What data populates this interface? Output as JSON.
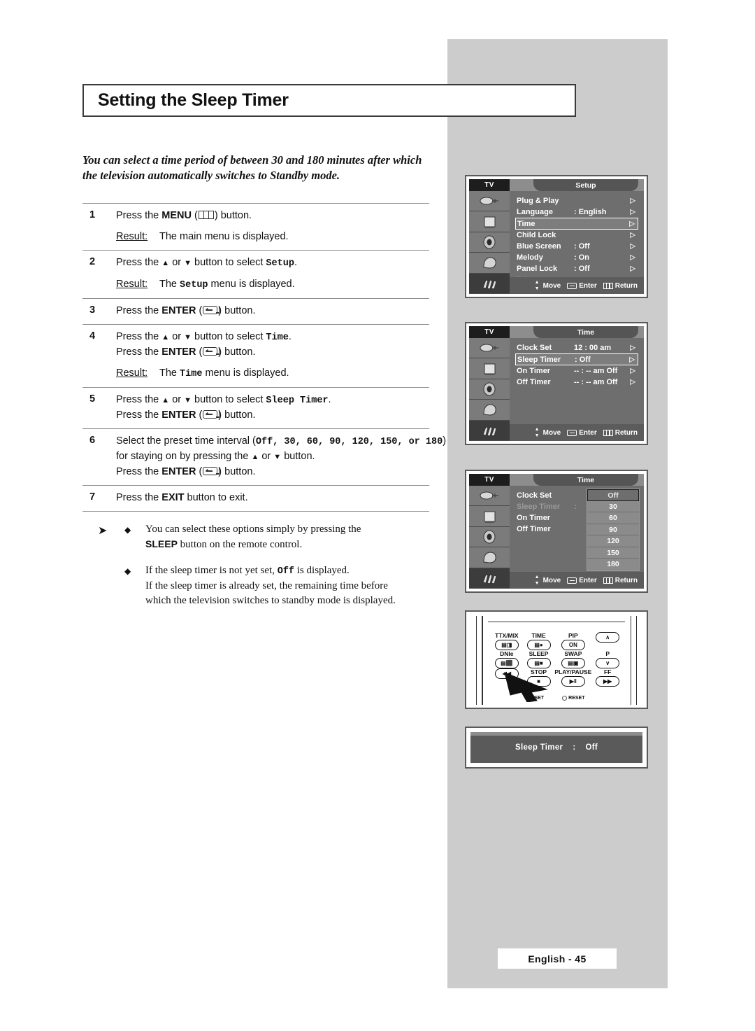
{
  "page": {
    "title": "Setting the Sleep Timer",
    "intro": "You can select a time period of between 30 and 180 minutes after which the television automatically switches to Standby mode.",
    "footer": "English - 45"
  },
  "steps": [
    {
      "num": "1",
      "line1_pre": "Press the ",
      "line1_bold": "MENU",
      "line1_icon": "menu-icon",
      "line1_post": ") button.",
      "result_label": "Result:",
      "result_pre": "The main menu is displayed.",
      "result_mono": "",
      "result_post": ""
    },
    {
      "num": "2",
      "line1_pre": "Press the ",
      "line1_mid": " or ",
      "line1_post": " button to select ",
      "line1_mono": "Setup",
      "line1_end": ".",
      "result_label": "Result:",
      "result_pre": "The ",
      "result_mono": "Setup",
      "result_post": " menu is displayed."
    },
    {
      "num": "3",
      "line1_pre": "Press the ",
      "line1_bold": "ENTER",
      "line1_icon": "enter-icon",
      "line1_post": ") button."
    },
    {
      "num": "4",
      "line1_pre": "Press the ",
      "line1_mid": " or ",
      "line1_post": " button to select ",
      "line1_mono": "Time",
      "line1_end": ".",
      "line2_pre": "Press the ",
      "line2_bold": "ENTER",
      "line2_post": ") button.",
      "result_label": "Result:",
      "result_pre": "The ",
      "result_mono": "Time",
      "result_post": " menu is displayed."
    },
    {
      "num": "5",
      "line1_pre": "Press the ",
      "line1_mid": " or ",
      "line1_post": " button to select ",
      "line1_mono": "Sleep Timer",
      "line1_end": ".",
      "line2_pre": "Press the ",
      "line2_bold": "ENTER",
      "line2_post": ") button."
    },
    {
      "num": "6",
      "line1_pre": "Select the preset time interval (",
      "line1_opts": "Off, 30, 60, 90, 120, 150, or 180",
      "line1_end": ")",
      "line2": "for staying on by pressing the ",
      "line2_post": " button.",
      "line3_pre": "Press the ",
      "line3_bold": "ENTER",
      "line3_post": ") button."
    },
    {
      "num": "7",
      "line1_pre": "Press the ",
      "line1_bold": "EXIT",
      "line1_plain": " button to exit."
    }
  ],
  "notes": [
    {
      "arrow": "note-arrow-icon",
      "bullet": "diamond-bullet-icon",
      "line1": "You can select these options simply by pressing the",
      "bold": "SLEEP",
      "line2_rest": " button on the remote control."
    },
    {
      "bullet": "diamond-bullet-icon",
      "line1_pre": "If the sleep timer is not yet set, ",
      "line1_mono": "Off",
      "line1_post": " is displayed.",
      "line2": "If the sleep timer is already set, the remaining time before",
      "line3": "which the television switches to standby mode is displayed."
    }
  ],
  "osd_setup": {
    "tv_label": "TV",
    "title": "Setup",
    "rows": [
      {
        "label": "Plug & Play",
        "value": "",
        "caret": "▷",
        "state": "normal"
      },
      {
        "label": "Language",
        "value": ": English",
        "caret": "▷",
        "state": "normal"
      },
      {
        "label": "Time",
        "value": "",
        "caret": "▷",
        "state": "highlight"
      },
      {
        "label": "Child Lock",
        "value": "",
        "caret": "▷",
        "state": "normal"
      },
      {
        "label": "Blue Screen",
        "value": ": Off",
        "caret": "▷",
        "state": "normal"
      },
      {
        "label": "Melody",
        "value": ": On",
        "caret": "▷",
        "state": "normal"
      },
      {
        "label": "Panel Lock",
        "value": ": Off",
        "caret": "▷",
        "state": "normal"
      },
      {
        "label": "PC",
        "value": "",
        "caret": "▶",
        "state": "dim"
      }
    ],
    "bottom": {
      "move": "Move",
      "enter": "Enter",
      "return": "Return"
    }
  },
  "osd_time": {
    "tv_label": "TV",
    "title": "Time",
    "rows": [
      {
        "label": "Clock Set",
        "value": "12 : 00 am",
        "caret": "▷",
        "state": "normal"
      },
      {
        "label": "Sleep Timer",
        "value": ": Off",
        "caret": "▷",
        "state": "highlight"
      },
      {
        "label": "On Timer",
        "value": "-- : -- am Off",
        "caret": "▷",
        "state": "normal"
      },
      {
        "label": "Off Timer",
        "value": "-- : -- am Off",
        "caret": "▷",
        "state": "normal"
      }
    ],
    "bottom": {
      "move": "Move",
      "enter": "Enter",
      "return": "Return"
    }
  },
  "osd_time_values": {
    "tv_label": "TV",
    "title": "Time",
    "rows": [
      {
        "label": "Clock Set",
        "value": "",
        "state": "normal"
      },
      {
        "label": "Sleep Timer",
        "value": ":",
        "state": "dim"
      },
      {
        "label": "On Timer",
        "value": "",
        "state": "normal"
      },
      {
        "label": "Off Timer",
        "value": "",
        "state": "normal"
      }
    ],
    "values": [
      "Off",
      "30",
      "60",
      "90",
      "120",
      "150",
      "180"
    ],
    "selected_value": "Off",
    "bottom": {
      "move": "Move",
      "enter": "Enter",
      "return": "Return"
    }
  },
  "remote": {
    "buttons": [
      {
        "label": "TTX/MIX",
        "glyph": "▤◨"
      },
      {
        "label": "TIME",
        "glyph": "▤●"
      },
      {
        "label": "PIP",
        "glyph": "ON"
      },
      {
        "label": "",
        "glyph": "∧"
      },
      {
        "label": "DNIe",
        "glyph": "▤⬛"
      },
      {
        "label": "SLEEP",
        "glyph": "▤■"
      },
      {
        "label": "SWAP",
        "glyph": "▤▣"
      },
      {
        "label": "P",
        "glyph": "∨"
      },
      {
        "label": "",
        "glyph": "◀◀"
      },
      {
        "label": "STOP",
        "glyph": "■"
      },
      {
        "label": "PLAY/PAUSE",
        "glyph": "▶‖"
      },
      {
        "label": "FF",
        "glyph": "▶▶"
      }
    ],
    "set_label": "SET",
    "reset_label": "RESET"
  },
  "banner": {
    "label": "Sleep Timer",
    "separator": ":",
    "value": "Off"
  }
}
